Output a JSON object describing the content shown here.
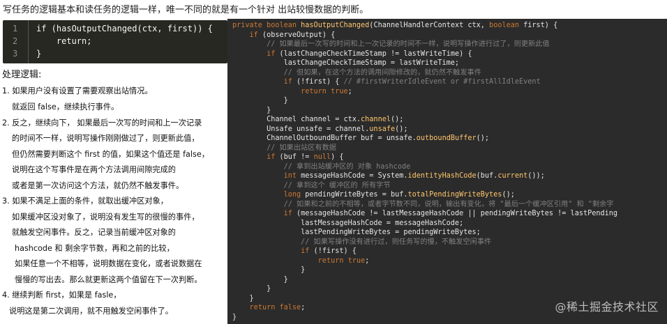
{
  "header": {
    "text": "写任务的逻辑基本和读任务的逻辑一样，唯一不同的就是有一个针对 出站较慢数据的判断。"
  },
  "snippet": {
    "line_numbers": [
      "1",
      "2",
      "3"
    ],
    "lines": [
      "if (hasOutputChanged(ctx, first)) {",
      "    return;",
      "}"
    ]
  },
  "code": {
    "lines": [
      "private boolean hasOutputChanged(ChannelHandlerContext ctx, boolean first) {",
      "    if (observeOutput) {",
      "        // 如果最后一次写的时间和上一次记录的时间不一样，说明写操作进行过了，则更新此值",
      "        if (lastChangeCheckTimeStamp != lastWriteTime) {",
      "            lastChangeCheckTimeStamp = lastWriteTime;",
      "            // 但如果，在这个方法的调用间隙修改的，就仍然不触发事件",
      "            if (!first) { // #firstWriterIdleEvent or #firstAllIdleEvent",
      "                return true;",
      "            }",
      "        }",
      "        Channel channel = ctx.channel();",
      "        Unsafe unsafe = channel.unsafe();",
      "        ChannelOutboundBuffer buf = unsafe.outboundBuffer();",
      "        // 如果出站区有数据",
      "        if (buf != null) {",
      "            // 拿到出站缓冲区的 对象 hashcode",
      "            int messageHashCode = System.identityHashCode(buf.current());",
      "            // 拿到这个 缓冲区的 所有字节",
      "            long pendingWriteBytes = buf.totalPendingWriteBytes();",
      "            // 如果和之前的不相等，或者字节数不同，说明，输出有变化，将 \"最后一个缓冲区引用\" 和 \"剩余字",
      "            if (messageHashCode != lastMessageHashCode || pendingWriteBytes != lastPending",
      "                lastMessageHashCode = messageHashCode;",
      "                lastPendingWriteBytes = pendingWriteBytes;",
      "                // 如果写操作没有进行过，则任务写的慢，不触发空闲事件",
      "                if (!first) {",
      "                    return true;",
      "                }",
      "            }",
      "        }",
      "    }",
      "    return false;",
      "}"
    ]
  },
  "explanation": {
    "title": "处理逻辑:",
    "lines": [
      "1. 如果用户没有设置了需要观察出站情况。",
      "就返回 false，继续执行事件。",
      "2. 反之，继续向下， 如果最后一次写的时间和上一次记录",
      "的时间不一样，说明写操作刚刚做过了，则更新此值，",
      "但仍然需要判断这个 first 的值，如果这个值还是 false，",
      "说明在这个写事件是在两个方法调用间隙完成的",
      "或者是第一次访问这个方法，就仍然不触发事件。",
      "3. 如果不满足上面的条件，就取出缓冲区对象，",
      "如果缓冲区没对象了，说明没有发生写的很慢的事件，",
      "就触发空闲事件。反之，记录当前缓冲区对象的",
      "hashcode 和 剩余字节数，再和之前的比较，",
      "如果任意一个不相等，说明数据在变化，或者说数据在",
      "慢慢的写出去。那么就更新这两个值留在下一次判断。",
      "4. 继续判断 first，如果是 fasle，",
      "说明这是第二次调用，就不用触发空闲事件了。"
    ]
  },
  "watermark": "@稀土掘金技术社区"
}
